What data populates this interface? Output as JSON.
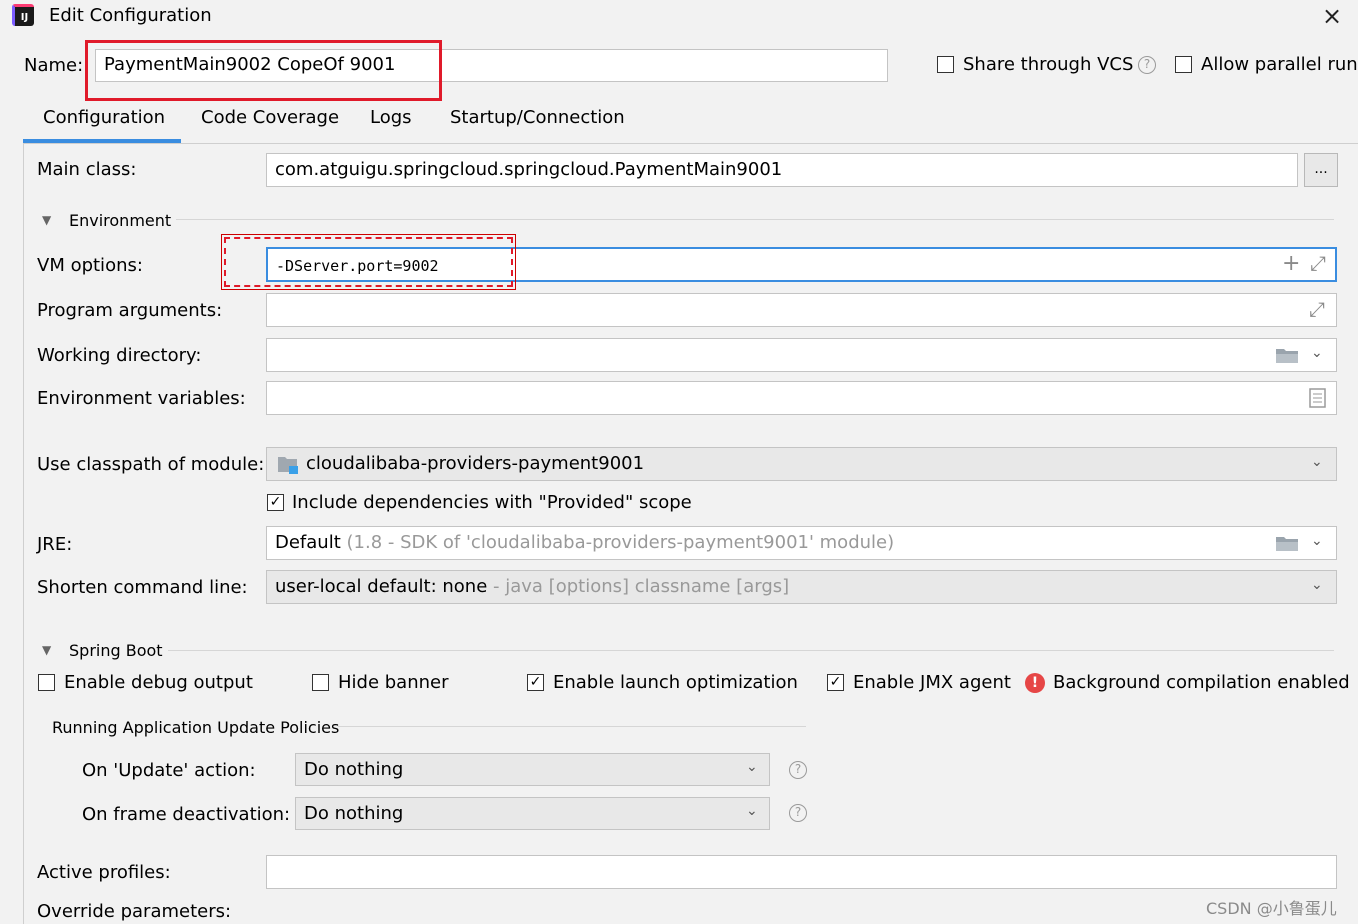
{
  "window": {
    "title": "Edit Configuration",
    "close_icon": "×",
    "app_icon": "IJ"
  },
  "name_row": {
    "label": "Name:",
    "value": "PaymentMain9002 CopeOf 9001"
  },
  "vcs": {
    "share_label": "Share through VCS",
    "share_checked": false,
    "parallel_label": "Allow parallel run",
    "parallel_checked": false,
    "help_icon": "?"
  },
  "tabs": [
    {
      "label": "Configuration",
      "active": true
    },
    {
      "label": "Code Coverage",
      "active": false
    },
    {
      "label": "Logs",
      "active": false
    },
    {
      "label": "Startup/Connection",
      "active": false
    }
  ],
  "main_class": {
    "label": "Main class:",
    "value": "com.atguigu.springcloud.springcloud.PaymentMain9001",
    "browse": "..."
  },
  "environment": {
    "section_label": "Environment",
    "vm_options": {
      "label": "VM options:",
      "value": "-DServer.port=9002",
      "add_icon": "+",
      "expand_icon": "⤢"
    },
    "program_arguments": {
      "label": "Program arguments:",
      "value": ""
    },
    "working_directory": {
      "label": "Working directory:",
      "value": ""
    },
    "environment_variables": {
      "label": "Environment variables:",
      "value": ""
    }
  },
  "classpath": {
    "label": "Use classpath of module:",
    "value": "cloudalibaba-providers-payment9001"
  },
  "include_deps": {
    "label": "Include dependencies with \"Provided\" scope",
    "checked": true
  },
  "jre": {
    "label": "JRE:",
    "value": "Default",
    "hint": "(1.8 - SDK of 'cloudalibaba-providers-payment9001' module)"
  },
  "shorten": {
    "label": "Shorten command line:",
    "value": "user-local default: none",
    "hint": " - java [options] classname [args]"
  },
  "spring_boot": {
    "section_label": "Spring Boot",
    "debug_output": {
      "label": "Enable debug output",
      "checked": false
    },
    "hide_banner": {
      "label": "Hide banner",
      "checked": false
    },
    "launch_opt": {
      "label": "Enable launch optimization",
      "checked": true
    },
    "jmx_agent": {
      "label": "Enable JMX agent",
      "checked": true
    },
    "bg_compile": {
      "label": "Background compilation enabled",
      "icon": "!"
    },
    "policies_label": "Running Application Update Policies",
    "update_action": {
      "label": "On 'Update' action:",
      "value": "Do nothing"
    },
    "frame_deactivation": {
      "label": "On frame deactivation:",
      "value": "Do nothing"
    },
    "active_profiles": {
      "label": "Active profiles:",
      "value": ""
    },
    "override_params": {
      "label": "Override parameters:"
    }
  },
  "watermark": "CSDN @小鲁蛋儿",
  "colors": {
    "accent": "#3a8de0",
    "highlight": "#e01a2a",
    "error": "#e64646"
  }
}
